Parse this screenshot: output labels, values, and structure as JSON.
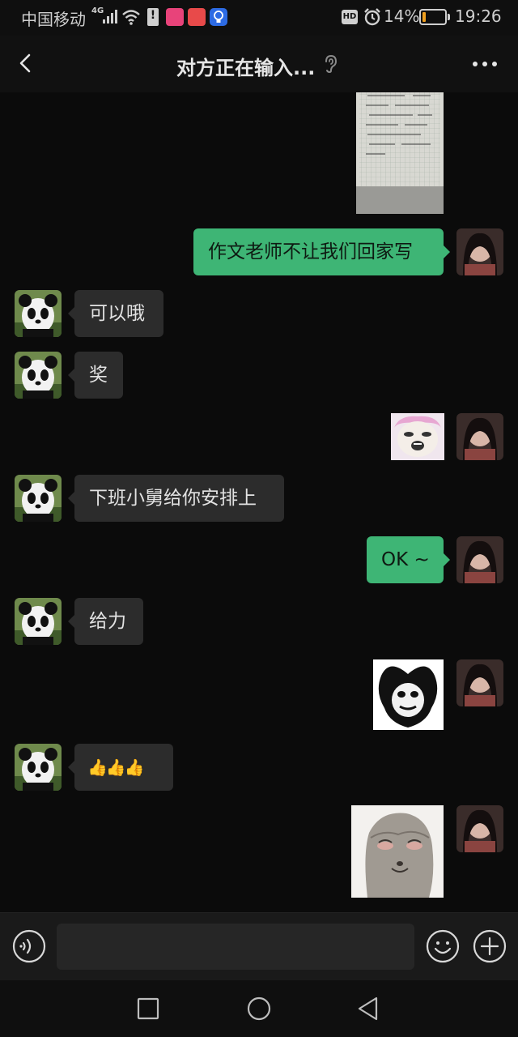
{
  "status_bar": {
    "carrier": "中国移动",
    "network": "4G",
    "hd_label": "HD",
    "battery_text": "14%",
    "battery_level": 0.14,
    "battery_color": "#f0a020",
    "time": "19:26"
  },
  "header": {
    "title": "对方正在输入...",
    "back_icon": "chevron-left",
    "mute_icon": "ear",
    "more_icon": "ellipsis"
  },
  "colors": {
    "background": "#0b0b0b",
    "bubble_me": "#3eb575",
    "bubble_other": "#2c2c2c"
  },
  "messages": [
    {
      "sender": "me",
      "type": "image",
      "content": "作文纸照片"
    },
    {
      "sender": "me",
      "type": "text",
      "text": "作文老师不让我们回家写"
    },
    {
      "sender": "other",
      "type": "text",
      "text": "可以哦"
    },
    {
      "sender": "other",
      "type": "text",
      "text": "奖"
    },
    {
      "sender": "me",
      "type": "sticker",
      "content": "粉色表情包"
    },
    {
      "sender": "other",
      "type": "text",
      "text": "下班小舅给你安排上"
    },
    {
      "sender": "me",
      "type": "text",
      "text": "OK ~"
    },
    {
      "sender": "other",
      "type": "text",
      "text": "给力"
    },
    {
      "sender": "me",
      "type": "sticker",
      "content": "熊猫头表情包"
    },
    {
      "sender": "other",
      "type": "text",
      "text": "👍👍👍"
    },
    {
      "sender": "me",
      "type": "sticker",
      "content": "小熊表情包"
    }
  ],
  "input_bar": {
    "value": "",
    "voice_icon": "voice",
    "emoji_icon": "smiley",
    "plus_icon": "plus"
  },
  "nav_bar": {
    "icons": [
      "square",
      "circle",
      "triangle-back"
    ]
  }
}
